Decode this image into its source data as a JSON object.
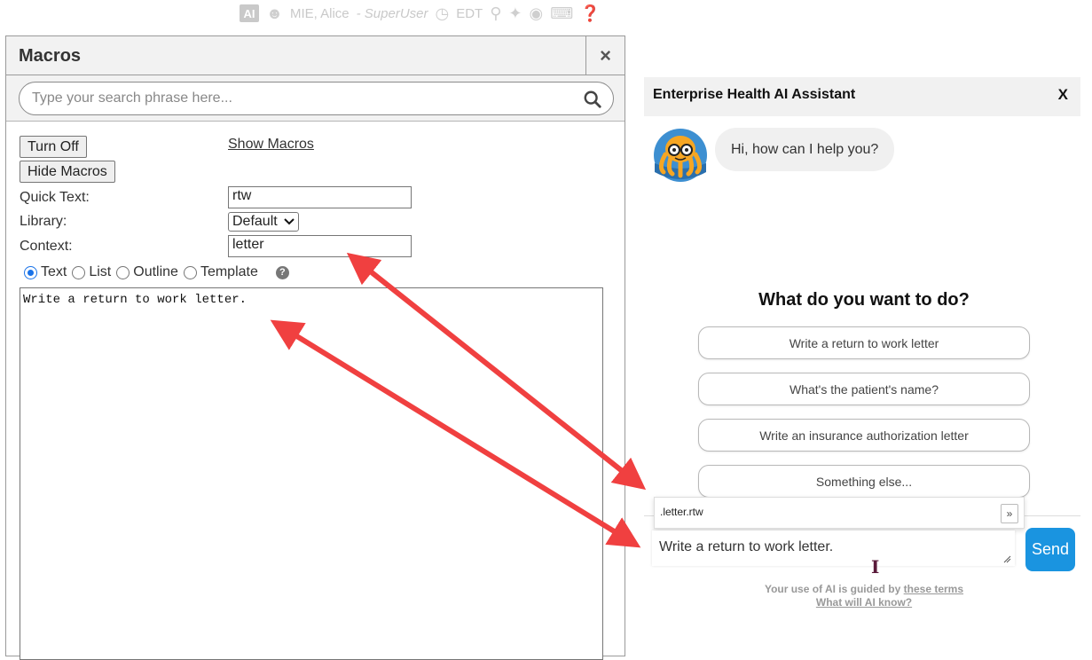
{
  "topbar": {
    "ai_badge": "AI",
    "user_name": "MIE, Alice",
    "role": "- SuperUser",
    "timezone": "EDT"
  },
  "macros": {
    "title": "Macros",
    "close_label": "×",
    "search_placeholder": "Type your search phrase here...",
    "turn_off_label": "Turn Off",
    "show_macros_label": "Show Macros",
    "hide_macros_label": "Hide Macros",
    "quick_text_label": "Quick Text:",
    "quick_text_value": "rtw",
    "library_label": "Library:",
    "library_value": "Default",
    "context_label": "Context:",
    "context_value": "letter",
    "radio_text": "Text",
    "radio_list": "List",
    "radio_outline": "Outline",
    "radio_template": "Template",
    "help_label": "?",
    "body_text": "Write a return to work letter."
  },
  "assistant": {
    "title": "Enterprise Health AI Assistant",
    "close_label": "X",
    "greeting": "Hi, how can I help you?",
    "prompt_title": "What do you want to do?",
    "suggestions": [
      "Write a return to work letter",
      "What's the patient's name?",
      "Write an insurance authorization letter",
      "Something else..."
    ],
    "macro_popup": ".letter.rtw",
    "expand_label": "»",
    "input_value": "Write a return to work letter.",
    "send_label": "Send",
    "disclaimer_prefix": "Your use of AI is guided by",
    "disclaimer_link": "these terms",
    "ai_know_link": "What will AI know?"
  },
  "colors": {
    "send_button": "#1a94e0",
    "arrow": "#f04040",
    "header_bg": "#f1f1f1"
  }
}
